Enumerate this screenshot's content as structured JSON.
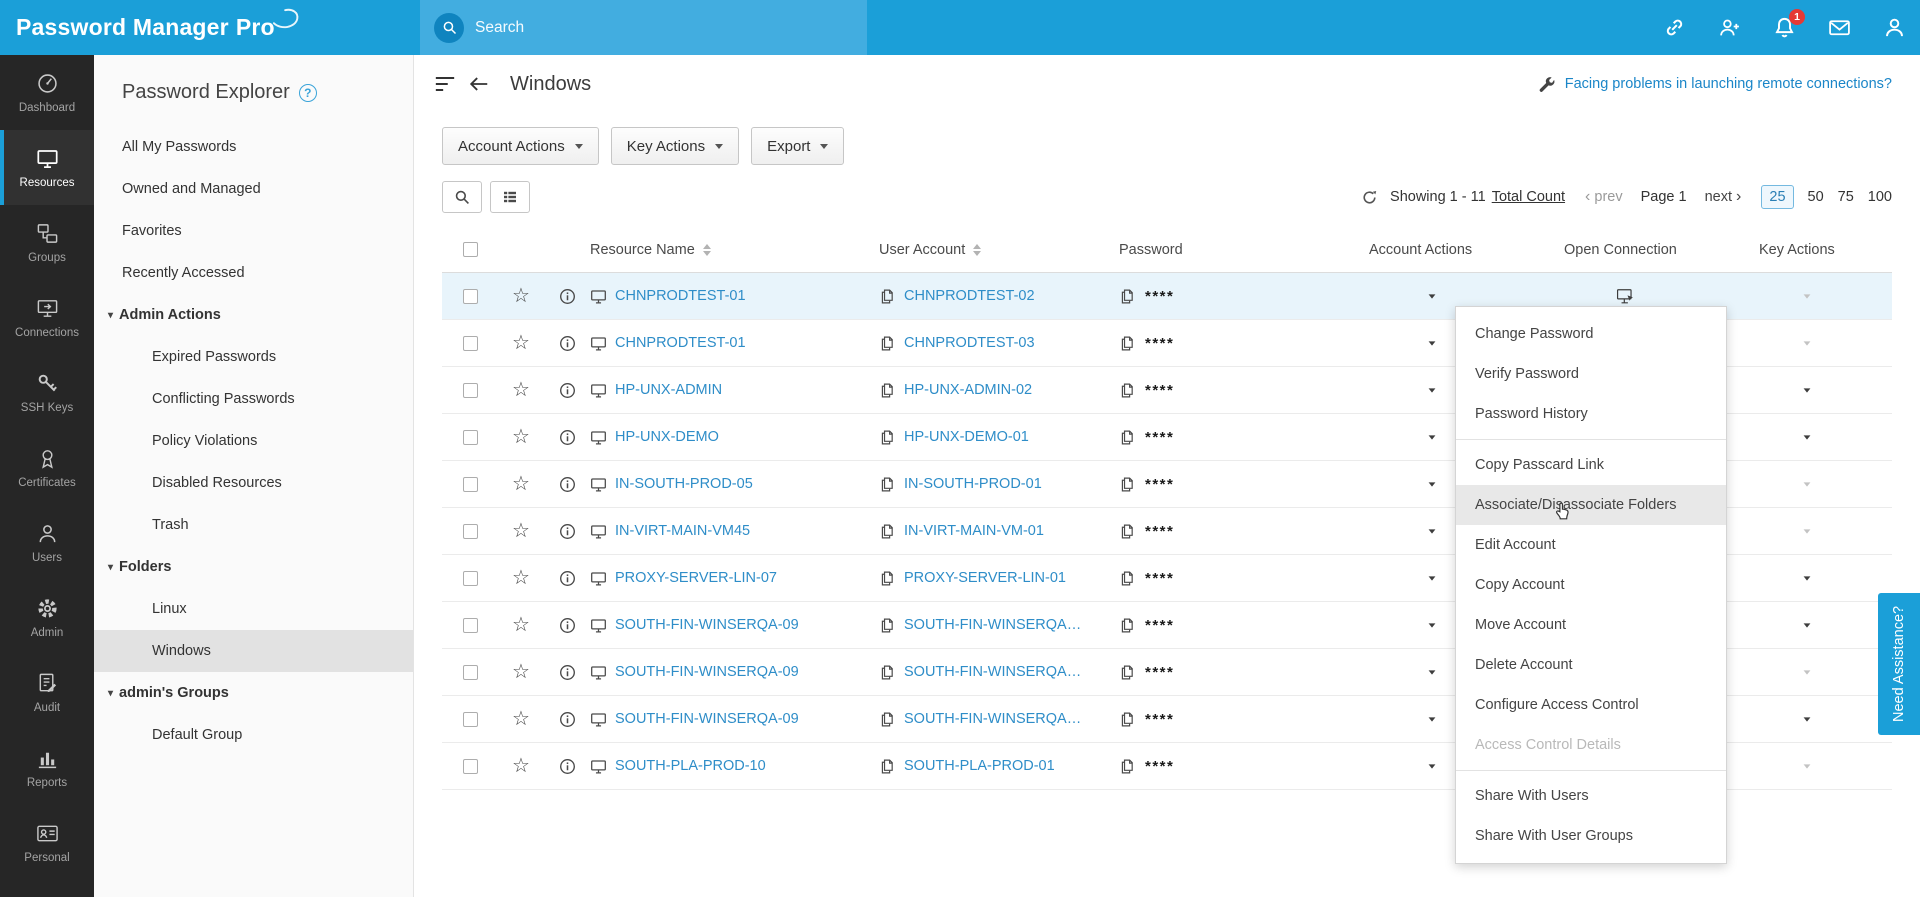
{
  "colors": {
    "accent": "#1b9fd8",
    "search_band": "#42ade0",
    "link": "#2e8dc8",
    "badge": "#e53935",
    "selected_row": "#e8f4fb",
    "sidebar_bg": "#262626"
  },
  "topbar": {
    "logo_text": "Password Manager",
    "logo_pro": "Pro",
    "search_placeholder": "Search",
    "icons": [
      {
        "name": "chain-icon"
      },
      {
        "name": "user-add-icon"
      },
      {
        "name": "bell-icon",
        "badge": "1"
      },
      {
        "name": "mail-icon"
      },
      {
        "name": "profile-icon"
      }
    ]
  },
  "nav": {
    "items": [
      {
        "label": "Dashboard",
        "icon": "gauge-icon"
      },
      {
        "label": "Resources",
        "icon": "monitor-icon",
        "active": true
      },
      {
        "label": "Groups",
        "icon": "groups-icon"
      },
      {
        "label": "Connections",
        "icon": "connections-icon"
      },
      {
        "label": "SSH Keys",
        "icon": "key-icon"
      },
      {
        "label": "Certificates",
        "icon": "certificate-icon"
      },
      {
        "label": "Users",
        "icon": "user-icon"
      },
      {
        "label": "Admin",
        "icon": "gear-icon"
      },
      {
        "label": "Audit",
        "icon": "audit-icon"
      },
      {
        "label": "Reports",
        "icon": "reports-icon"
      },
      {
        "label": "Personal",
        "icon": "idcard-icon"
      }
    ]
  },
  "explorer": {
    "title": "Password Explorer",
    "items": [
      {
        "label": "All My Passwords",
        "type": "item"
      },
      {
        "label": "Owned and Managed",
        "type": "item"
      },
      {
        "label": "Favorites",
        "type": "item"
      },
      {
        "label": "Recently Accessed",
        "type": "item"
      },
      {
        "label": "Admin Actions",
        "type": "group"
      },
      {
        "label": "Expired Passwords",
        "type": "sub"
      },
      {
        "label": "Conflicting Passwords",
        "type": "sub"
      },
      {
        "label": "Policy Violations",
        "type": "sub"
      },
      {
        "label": "Disabled Resources",
        "type": "sub"
      },
      {
        "label": "Trash",
        "type": "sub"
      },
      {
        "label": "Folders",
        "type": "group"
      },
      {
        "label": "Linux",
        "type": "sub"
      },
      {
        "label": "Windows",
        "type": "sub",
        "active": true
      },
      {
        "label": "admin's Groups",
        "type": "group"
      },
      {
        "label": "Default Group",
        "type": "sub"
      }
    ]
  },
  "main": {
    "title": "Windows",
    "remote_link": "Facing problems in launching remote connections?",
    "toolbar": {
      "account_actions": "Account Actions",
      "key_actions": "Key Actions",
      "export": "Export"
    },
    "pagination": {
      "showing": "Showing 1 - 11",
      "total_count": "Total Count",
      "prev": "prev",
      "page": "Page 1",
      "next": "next",
      "sizes": [
        "25",
        "50",
        "75",
        "100"
      ],
      "active_size": "25"
    },
    "table": {
      "headers": [
        {
          "label": "Resource Name",
          "sortable": true
        },
        {
          "label": "User Account",
          "sortable": true
        },
        {
          "label": "Password"
        },
        {
          "label": "Account Actions"
        },
        {
          "label": "Open Connection"
        },
        {
          "label": "Key Actions"
        }
      ],
      "password_mask": "****",
      "rows": [
        {
          "resource": "CHNPRODTEST-01",
          "account": "CHNPRODTEST-02",
          "selected": true,
          "key_enabled": false
        },
        {
          "resource": "CHNPRODTEST-01",
          "account": "CHNPRODTEST-03",
          "key_enabled": false
        },
        {
          "resource": "HP-UNX-ADMIN",
          "account": "HP-UNX-ADMIN-02",
          "key_enabled": true
        },
        {
          "resource": "HP-UNX-DEMO",
          "account": "HP-UNX-DEMO-01",
          "key_enabled": true
        },
        {
          "resource": "IN-SOUTH-PROD-05",
          "account": "IN-SOUTH-PROD-01",
          "key_enabled": false
        },
        {
          "resource": "IN-VIRT-MAIN-VM45",
          "account": "IN-VIRT-MAIN-VM-01",
          "key_enabled": false
        },
        {
          "resource": "PROXY-SERVER-LIN-07",
          "account": "PROXY-SERVER-LIN-01",
          "key_enabled": true
        },
        {
          "resource": "SOUTH-FIN-WINSERQA-09",
          "account": "SOUTH-FIN-WINSERQA…",
          "key_enabled": true
        },
        {
          "resource": "SOUTH-FIN-WINSERQA-09",
          "account": "SOUTH-FIN-WINSERQA…",
          "key_enabled": false
        },
        {
          "resource": "SOUTH-FIN-WINSERQA-09",
          "account": "SOUTH-FIN-WINSERQA…",
          "key_enabled": true
        },
        {
          "resource": "SOUTH-PLA-PROD-10",
          "account": "SOUTH-PLA-PROD-01",
          "key_enabled": false
        }
      ]
    },
    "context_menu": {
      "items": [
        {
          "label": "Change Password"
        },
        {
          "label": "Verify Password"
        },
        {
          "label": "Password History",
          "divider_after": true
        },
        {
          "label": "Copy Passcard Link"
        },
        {
          "label": "Associate/Disassociate Folders",
          "hover": true
        },
        {
          "label": "Edit Account"
        },
        {
          "label": "Copy Account"
        },
        {
          "label": "Move Account"
        },
        {
          "label": "Delete Account"
        },
        {
          "label": "Configure Access Control"
        },
        {
          "label": "Access Control Details",
          "disabled": true,
          "divider_after": true
        },
        {
          "label": "Share With Users"
        },
        {
          "label": "Share With User Groups"
        }
      ]
    },
    "need_assistance": "Need Assistance?"
  }
}
